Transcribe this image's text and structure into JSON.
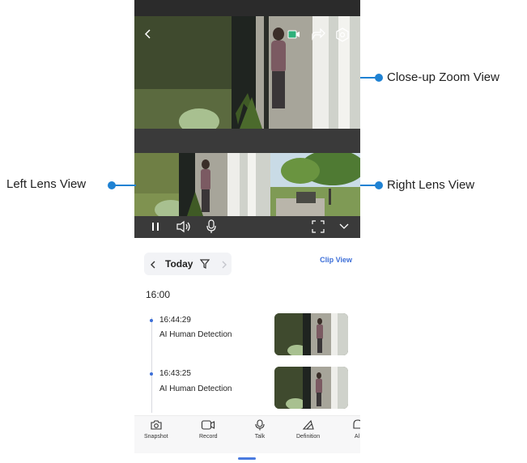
{
  "callouts": {
    "zoom": "Close-up Zoom View",
    "left": "Left Lens View",
    "right": "Right Lens View"
  },
  "player_controls": [
    "pause-icon",
    "volume-icon",
    "mic-icon",
    "fullscreen-icon",
    "chevron-down-icon"
  ],
  "timeline": {
    "date": "Today",
    "clip_view": "Clip View",
    "hour": "16:00",
    "events": [
      {
        "time": "16:44:29",
        "label": "AI Human Detection"
      },
      {
        "time": "16:43:25",
        "label": "AI Human Detection"
      }
    ]
  },
  "nav": {
    "items": [
      {
        "label": "Snapshot",
        "icon": "camera-icon"
      },
      {
        "label": "Record",
        "icon": "record-icon"
      },
      {
        "label": "Talk",
        "icon": "mic-icon"
      },
      {
        "label": "Definition",
        "icon": "definition-icon"
      },
      {
        "label": "Al",
        "icon": "ai-icon"
      }
    ]
  },
  "colors": {
    "accent": "#3d6fd8",
    "callout": "#1f82d3",
    "record_badge": "#2eb07a"
  }
}
